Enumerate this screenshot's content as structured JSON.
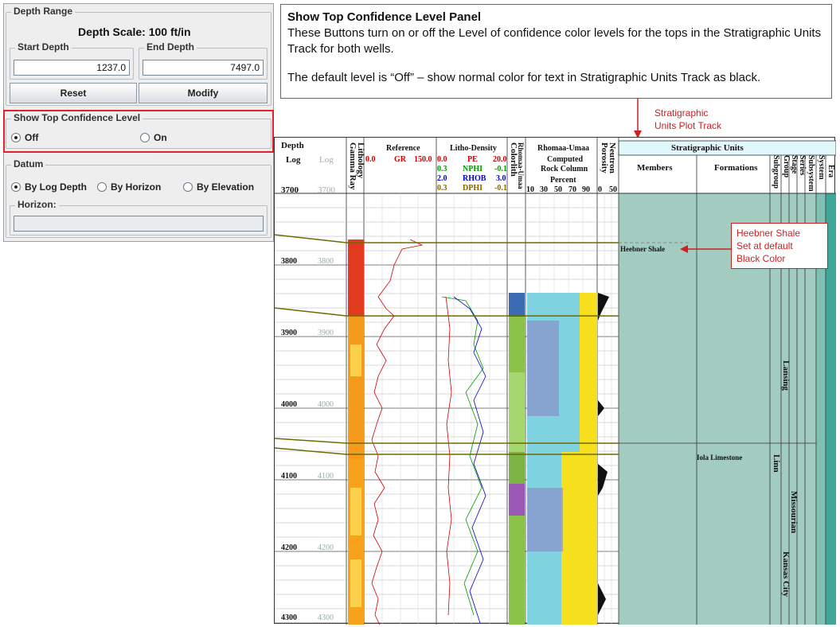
{
  "depth_range": {
    "title": "Depth Range",
    "scale_text": "Depth Scale: 100 ft/in",
    "start_label": "Start Depth",
    "start_value": "1237.0",
    "end_label": "End Depth",
    "end_value": "7497.0",
    "reset_label": "Reset",
    "modify_label": "Modify"
  },
  "confidence": {
    "title": "Show Top Confidence Level",
    "off_label": "Off",
    "on_label": "On",
    "selected": "Off"
  },
  "datum": {
    "title": "Datum",
    "options": [
      "By Log Depth",
      "By Horizon",
      "By Elevation"
    ],
    "selected": "By Log Depth",
    "horizon_label": "Horizon:",
    "horizon_value": ""
  },
  "notes": {
    "panel_title": "Show Top Confidence Level Panel",
    "line1": "These Buttons turn on or off the Level of confidence color levels for the tops in the Stratigraphic Units Track for both wells.",
    "line2": "The default level is “Off” – show normal color for text in Stratigraphic Units Track as black.",
    "track_callout_1": "Stratigraphic",
    "track_callout_2": "Units Plot Track",
    "heebner_1": "Heebner Shale",
    "heebner_2": "Set at default",
    "heebner_3": "Black Color"
  },
  "plot": {
    "depth_header_1": "Depth",
    "depth_header_2": "Log",
    "depth_header_3": "Log",
    "depth_top": "3700",
    "depth_top_2": "3700",
    "depth_ticks": [
      "3800",
      "3900",
      "4000",
      "4100",
      "4200",
      "4300"
    ],
    "gamma_ray": "Gamma Ray",
    "lithology": "Lithology",
    "reference": "Reference",
    "gr": "GR",
    "gr_min": "0.0",
    "gr_max": "150.0",
    "litho_density": "Litho-Density",
    "curves": [
      {
        "min": "0.0",
        "name": "PE",
        "max": "20.0",
        "color": "#cc0000"
      },
      {
        "min": "0.3",
        "name": "NPHI",
        "max": "-0.1",
        "color": "#009900"
      },
      {
        "min": "2.0",
        "name": "RHOB",
        "max": "3.0",
        "color": "#0000cc"
      },
      {
        "min": "0.3",
        "name": "DPHI",
        "max": "-0.1",
        "color": "#886600"
      }
    ],
    "colorlith": "Colorlith",
    "rhomaa_umaa_v": "Rhomaa-Umaa",
    "rhomaa_umaa": "Rhomaa-Umaa",
    "computed": "Computed",
    "rock_column": "Rock Column",
    "percent": "Percent",
    "pct_ticks": [
      "10",
      "30",
      "50",
      "70",
      "90"
    ],
    "porosity": "Porosity",
    "neutron": "Neutron",
    "neutron_min": "0",
    "neutron_max": "50",
    "strat_units": "Stratigraphic Units",
    "members": "Members",
    "formations": "Formations",
    "vertical_cols": [
      "Subgroup",
      "Group",
      "Stage",
      "Series",
      "Subsystem",
      "System",
      "Era"
    ],
    "heebner_shale": "Heebner Shale",
    "iola_limestone": "Iola Limestone",
    "lansing": "Lansing",
    "linn": "Linn",
    "missourian": "Missourian",
    "kansas_city": "Kansas City"
  }
}
